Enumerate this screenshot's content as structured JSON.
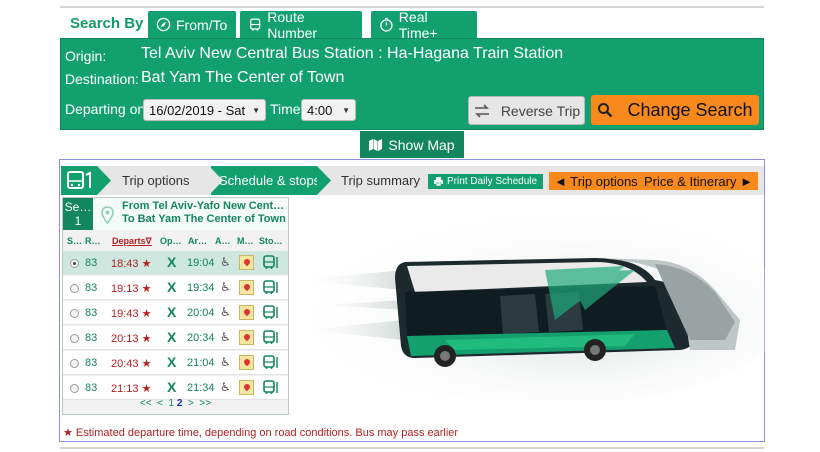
{
  "search": {
    "search_by": "Search By",
    "tabs": [
      {
        "label": "From/To",
        "icon": "compass-icon"
      },
      {
        "label": "Route Number",
        "icon": "bus-icon"
      },
      {
        "label": "Real Time+",
        "icon": "stopwatch-icon"
      }
    ]
  },
  "trip": {
    "origin_label": "Origin:",
    "origin": "Tel Aviv New Central Bus Station : Ha-Hagana Train Station",
    "destination_label": "Destination:",
    "destination": "Bat Yam The Center of Town",
    "departing_label": "Departing on",
    "date": "16/02/2019 - Sat",
    "time_label": "Time",
    "time": "4:00",
    "reverse_label": "Reverse Trip",
    "change_label": "Change Search",
    "show_map_label": "Show Map"
  },
  "steps": {
    "trip_options": "Trip options",
    "schedule": "Schedule & stops",
    "summary": "Trip summary",
    "print": "Print Daily Schedule",
    "prev": "◄ Trip options",
    "next": "Price & Itinerary ►"
  },
  "schedule": {
    "segment": "Se…",
    "segment_no": "1",
    "from": "From Tel Aviv-Yafo New Cent…",
    "to": "To Bat Yam The Center of Town",
    "columns": [
      "S…",
      "R…",
      "Departs∇",
      "Op…",
      "Ar…",
      "A…",
      "M…",
      "Sto…"
    ],
    "rows": [
      {
        "route": "83",
        "departs": "18:43 ★",
        "operator": "X",
        "arrives": "19:04",
        "accessible": "♿"
      },
      {
        "route": "83",
        "departs": "19:13 ★",
        "operator": "X",
        "arrives": "19:34",
        "accessible": "♿"
      },
      {
        "route": "83",
        "departs": "19:43 ★",
        "operator": "X",
        "arrives": "20:04",
        "accessible": "♿"
      },
      {
        "route": "83",
        "departs": "20:13 ★",
        "operator": "X",
        "arrives": "20:34",
        "accessible": "♿"
      },
      {
        "route": "83",
        "departs": "20:43 ★",
        "operator": "X",
        "arrives": "21:04",
        "accessible": "♿"
      },
      {
        "route": "83",
        "departs": "21:13 ★",
        "operator": "X",
        "arrives": "21:34",
        "accessible": "♿"
      }
    ],
    "pager": {
      "first": "<<",
      "prev": "<",
      "page1": "1",
      "page2": "2",
      "next": ">",
      "last": ">>"
    }
  },
  "footnote": "★ Estimated departure time, depending on road conditions. Bus may pass earlier",
  "colors": {
    "green": "#12a06f",
    "dark_green": "#13855f",
    "orange": "#f88a1d",
    "red": "#b22222"
  }
}
